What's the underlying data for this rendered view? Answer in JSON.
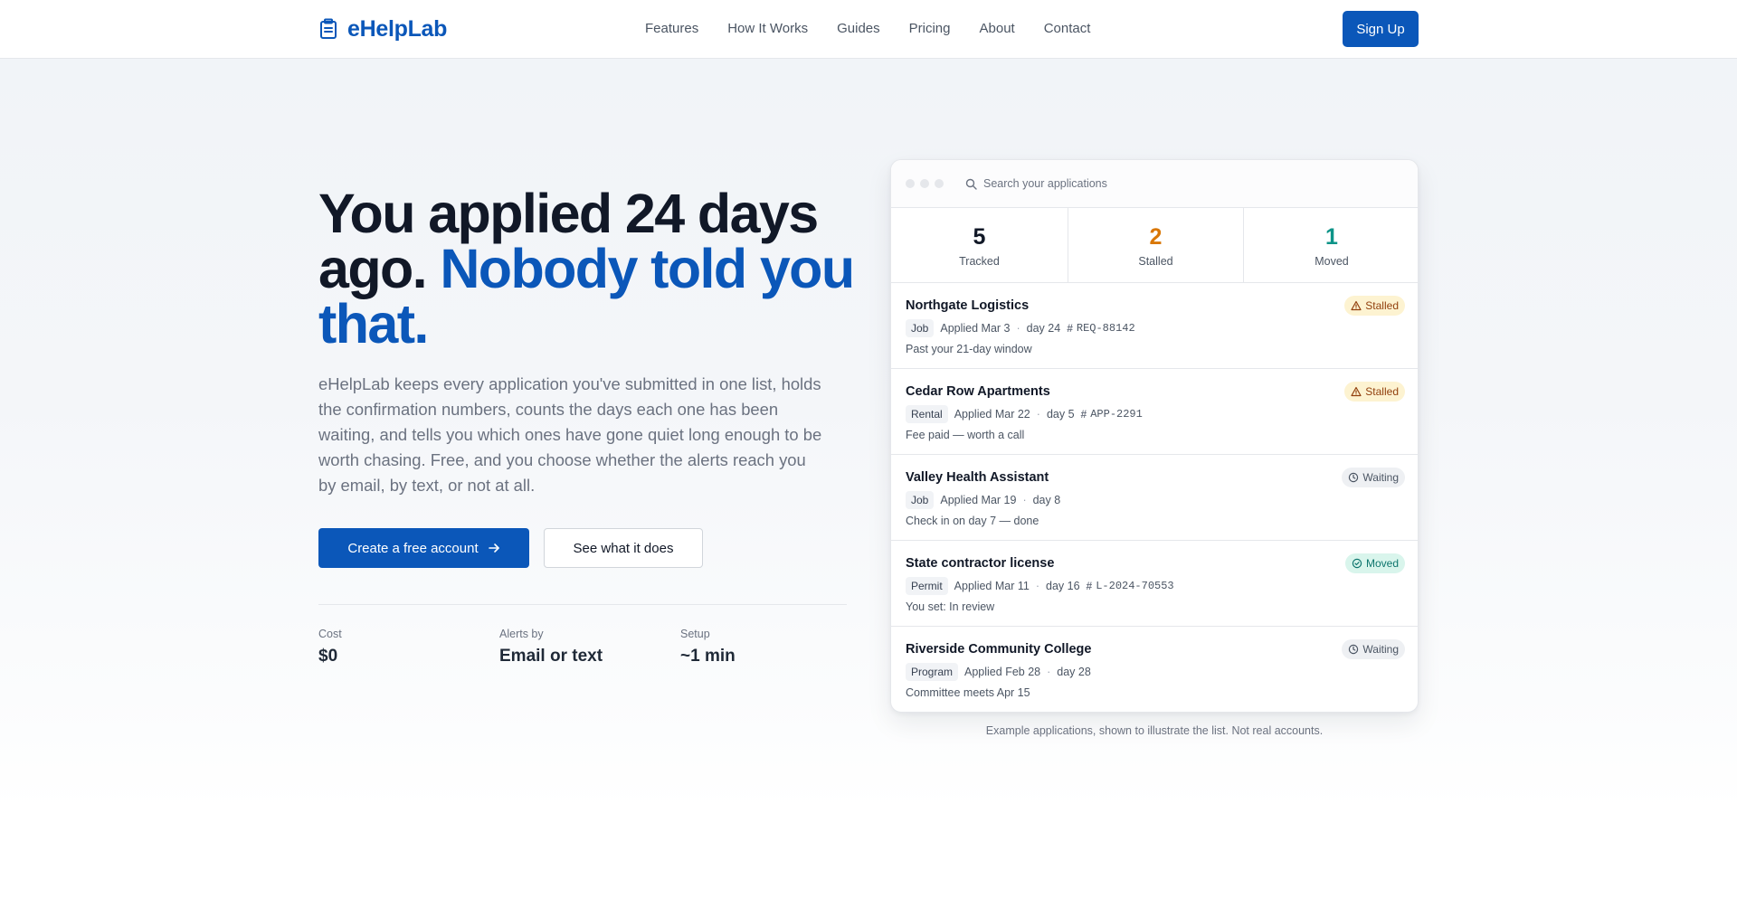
{
  "brand": {
    "name": "eHelpLab",
    "icon": "clipboard-icon",
    "color": "#0b57b9"
  },
  "nav": {
    "items": [
      "Features",
      "How It Works",
      "Guides",
      "Pricing",
      "About",
      "Contact"
    ]
  },
  "header": {
    "signup_label": "Sign Up"
  },
  "hero": {
    "headline_part1": "You applied 24 days ago.",
    "headline_part2": "Nobody told you that.",
    "lead": "eHelpLab keeps every application you've submitted in one list, holds the confirmation numbers, counts the days each one has been waiting, and tells you which ones have gone quiet long enough to be worth chasing. Free, and you choose whether the alerts reach you by email, by text, or not at all.",
    "primary_cta": "Create a free account",
    "primary_cta_icon": "arrow-right-icon",
    "secondary_cta": "See what it does",
    "stats": [
      {
        "label": "Cost",
        "value": "$0"
      },
      {
        "label": "Alerts by",
        "value": "Email or text"
      },
      {
        "label": "Setup",
        "value": "~1 min"
      }
    ]
  },
  "preview": {
    "search_placeholder": "Search your applications",
    "search_icon": "search-icon",
    "counts": [
      {
        "value": "5",
        "label": "Tracked",
        "color": "#111827"
      },
      {
        "value": "2",
        "label": "Stalled",
        "color": "#d97706"
      },
      {
        "value": "1",
        "label": "Moved",
        "color": "#0d9488"
      }
    ],
    "status_colors": {
      "stalled": "#92400e",
      "waiting": "#4b5563",
      "moved": "#0f766e"
    },
    "applications": [
      {
        "title": "Northgate Logistics",
        "tag": "Job",
        "applied": "Applied Mar 3",
        "day": "day 24",
        "ref": "REQ-88142",
        "note": "Past your 21-day window",
        "status": "Stalled",
        "status_icon": "warning-icon"
      },
      {
        "title": "Cedar Row Apartments",
        "tag": "Rental",
        "applied": "Applied Mar 22",
        "day": "day 5",
        "ref": "APP-2291",
        "note": "Fee paid — worth a call",
        "status": "Stalled",
        "status_icon": "warning-icon"
      },
      {
        "title": "Valley Health Assistant",
        "tag": "Job",
        "applied": "Applied Mar 19",
        "day": "day 8",
        "ref": "",
        "note": "Check in on day 7 — done",
        "status": "Waiting",
        "status_icon": "clock-icon"
      },
      {
        "title": "State contractor license",
        "tag": "Permit",
        "applied": "Applied Mar 11",
        "day": "day 16",
        "ref": "L-2024-70553",
        "note": "You set: In review",
        "status": "Moved",
        "status_icon": "check-circle-icon"
      },
      {
        "title": "Riverside Community College",
        "tag": "Program",
        "applied": "Applied Feb 28",
        "day": "day 28",
        "ref": "",
        "note": "Committee meets Apr 15",
        "status": "Waiting",
        "status_icon": "clock-icon"
      }
    ],
    "caption": "Example applications, shown to illustrate the list. Not real accounts."
  }
}
